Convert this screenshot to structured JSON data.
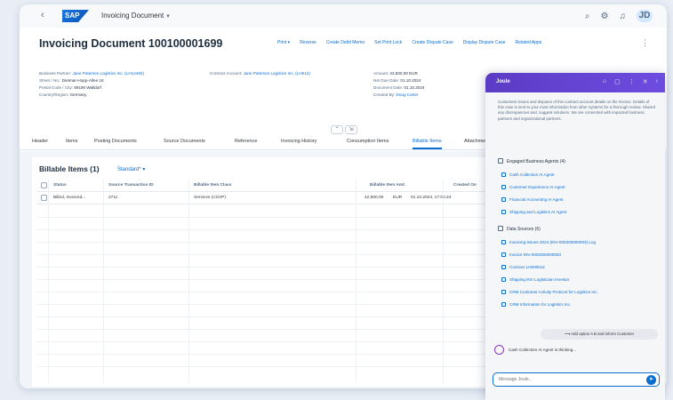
{
  "shell": {
    "back": "‹",
    "logo": "SAP",
    "app_title": "Invoicing Document",
    "app_chevron": "▾",
    "icons": [
      "⌕",
      "⚙",
      "♫"
    ],
    "avatar": "JD"
  },
  "header": {
    "title": "Invoicing Document 100100001699",
    "actions": [
      "Print ▾",
      "Reverse",
      "Create Debit Memo",
      "Set Print Lock",
      "Create Dispute Case",
      "Display Dispute Case",
      "Related Apps"
    ],
    "more_icon": "⋮"
  },
  "header_fields": [
    {
      "lines": [
        {
          "label": "Business Partner:",
          "value": "Jane Peterson Logistics Inc. (LH12460)",
          "link": true
        },
        {
          "label": "Street / No.:",
          "value": "Dietmar-Hopp-Allee 16",
          "link": false
        },
        {
          "label": "Postal Code / City:",
          "value": "69190 Walldorf",
          "link": false
        },
        {
          "label": "Country/Region:",
          "value": "Germany",
          "link": false
        }
      ]
    },
    {
      "lines": [
        {
          "label": "Contract Account:",
          "value": "Jane Peterson Logistics Inc. (LH012)",
          "link": true
        }
      ]
    },
    {
      "lines": [
        {
          "label": "Amount:",
          "value": "42,500.00 EUR",
          "link": false
        },
        {
          "label": "Net Due Date:",
          "value": "01.10.2024",
          "link": false
        },
        {
          "label": "Document Date:",
          "value": "01.10.2024",
          "link": false
        },
        {
          "label": "Created By:",
          "value": "Doug Carter",
          "link": true
        }
      ]
    }
  ],
  "collapse_buttons": [
    "⌃",
    "⇲"
  ],
  "tabs": [
    "Header",
    "Items",
    "Posting Documents",
    "Source Documents",
    "Reference",
    "Invoicing History",
    "Consumption Items",
    "Billable Items",
    "Attachments"
  ],
  "active_tab": 7,
  "table": {
    "title": "Billable Items (1)",
    "variant": "Standard* ▾",
    "columns": [
      "Status",
      "Source Transaction ID",
      "Billable Item Class",
      "Billable Item Amt.",
      "Created On"
    ],
    "rows": [
      {
        "status": "Billed, Invoiced...",
        "source_id": "2711",
        "class": "Services (CSVP)",
        "amount": "42,500.00",
        "currency": "EUR",
        "created": "01.10.2024, 17:05:24"
      }
    ]
  },
  "joule": {
    "title": "Joule",
    "header_icons": [
      "⌂",
      "▢",
      "⋮",
      "✕",
      "›"
    ],
    "intro": "Customers issues and disputes of this contract account details on the invoice. Details of this case is sent to your most information from other systems for a thorough review. Shared any discrepancies and, suggest solutions. We are connected with impacted business partners and organizational partners.",
    "engaged_title": "Engaged Business Agents (4)",
    "engaged_agents": [
      "Cash Collection AI Agent",
      "Customer Experience AI Agent",
      "Financial Accounting AI Agent",
      "Shipping and Logistics AI Agent"
    ],
    "sources_title": "Data Sources (6)",
    "sources": [
      "Invoicing Issues 2024 (INV-000200000003) Log",
      "Invoice INV-0002000000003",
      "Contract LH000012",
      "Shipping INV Logistician Investor",
      "CRM Customer Activity Protocol for Logistics Inc.",
      "CRM Information for Logistics Inc."
    ],
    "suggestion": "⟶ Add option A B and inform Customer",
    "status": "Cash Collection AI Agent is thinking...",
    "input_placeholder": "Message Joule...",
    "send_icon": "➤"
  }
}
